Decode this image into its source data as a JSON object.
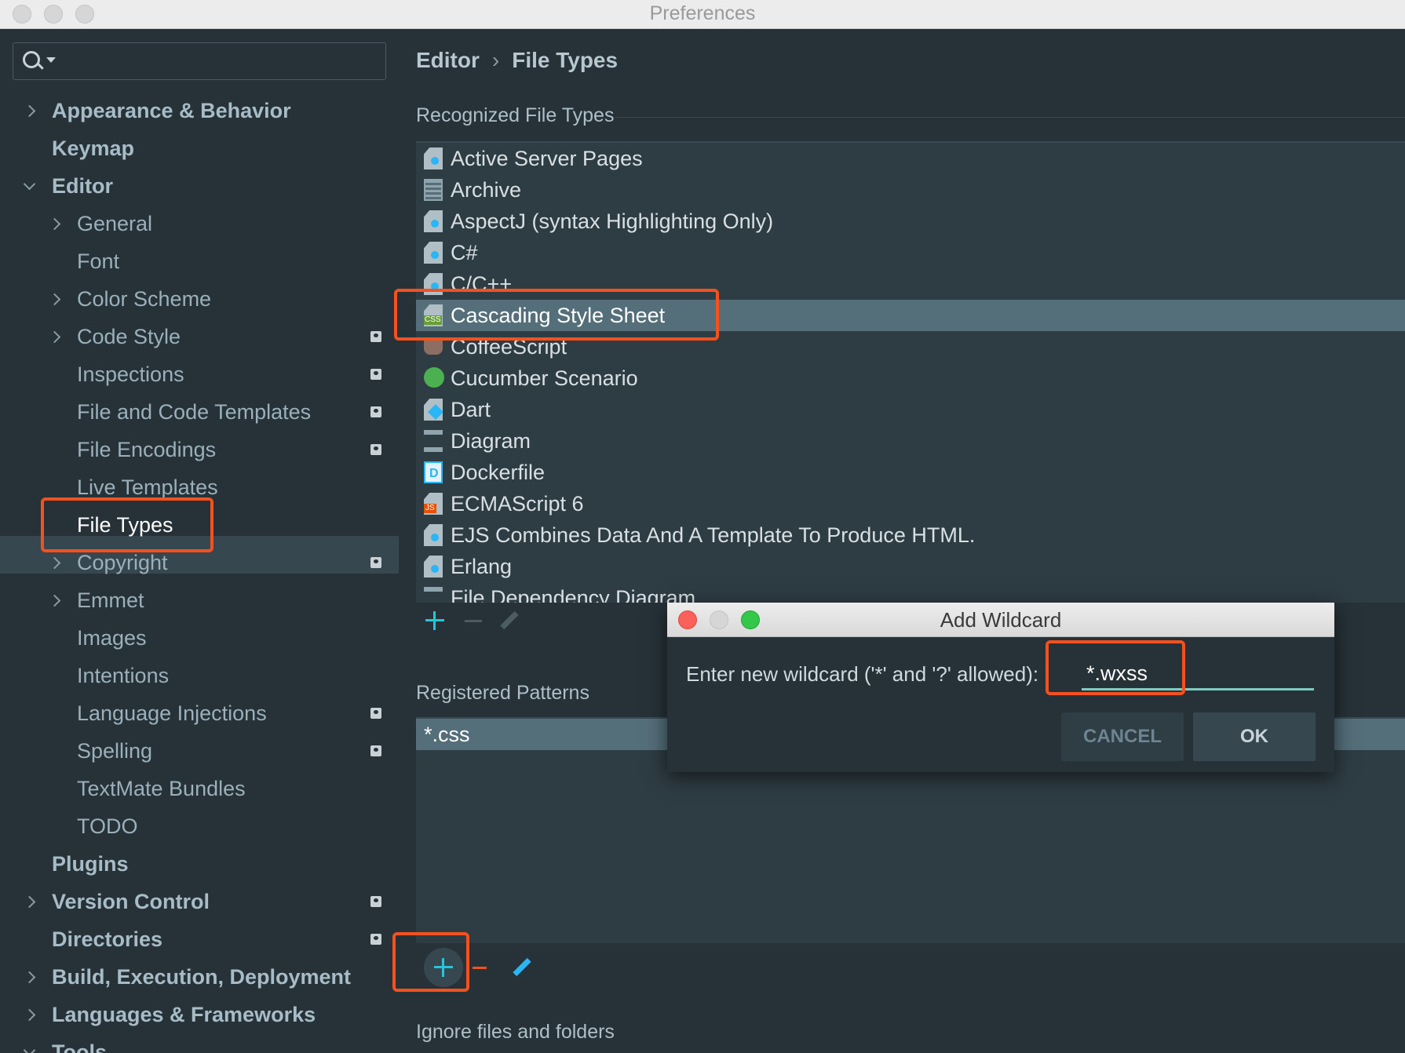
{
  "window": {
    "title": "Preferences"
  },
  "sidebar": {
    "items": [
      {
        "label": "Appearance & Behavior",
        "level": 0,
        "chevron": "right",
        "bold": true,
        "project": false
      },
      {
        "label": "Keymap",
        "level": 0,
        "chevron": "none",
        "bold": true,
        "project": false
      },
      {
        "label": "Editor",
        "level": 0,
        "chevron": "down",
        "bold": true,
        "project": false
      },
      {
        "label": "General",
        "level": 1,
        "chevron": "right",
        "bold": false,
        "project": false
      },
      {
        "label": "Font",
        "level": 1,
        "chevron": "none",
        "bold": false,
        "project": false
      },
      {
        "label": "Color Scheme",
        "level": 1,
        "chevron": "right",
        "bold": false,
        "project": false
      },
      {
        "label": "Code Style",
        "level": 1,
        "chevron": "right",
        "bold": false,
        "project": true
      },
      {
        "label": "Inspections",
        "level": 1,
        "chevron": "none",
        "bold": false,
        "project": true
      },
      {
        "label": "File and Code Templates",
        "level": 1,
        "chevron": "none",
        "bold": false,
        "project": true
      },
      {
        "label": "File Encodings",
        "level": 1,
        "chevron": "none",
        "bold": false,
        "project": true
      },
      {
        "label": "Live Templates",
        "level": 1,
        "chevron": "none",
        "bold": false,
        "project": false
      },
      {
        "label": "File Types",
        "level": 1,
        "chevron": "none",
        "bold": false,
        "project": false,
        "selected": true
      },
      {
        "label": "Copyright",
        "level": 1,
        "chevron": "right",
        "bold": false,
        "project": true
      },
      {
        "label": "Emmet",
        "level": 1,
        "chevron": "right",
        "bold": false,
        "project": false
      },
      {
        "label": "Images",
        "level": 1,
        "chevron": "none",
        "bold": false,
        "project": false
      },
      {
        "label": "Intentions",
        "level": 1,
        "chevron": "none",
        "bold": false,
        "project": false
      },
      {
        "label": "Language Injections",
        "level": 1,
        "chevron": "none",
        "bold": false,
        "project": true
      },
      {
        "label": "Spelling",
        "level": 1,
        "chevron": "none",
        "bold": false,
        "project": true
      },
      {
        "label": "TextMate Bundles",
        "level": 1,
        "chevron": "none",
        "bold": false,
        "project": false
      },
      {
        "label": "TODO",
        "level": 1,
        "chevron": "none",
        "bold": false,
        "project": false
      },
      {
        "label": "Plugins",
        "level": 0,
        "chevron": "none",
        "bold": true,
        "project": false
      },
      {
        "label": "Version Control",
        "level": 0,
        "chevron": "right",
        "bold": true,
        "project": true
      },
      {
        "label": "Directories",
        "level": 0,
        "chevron": "none",
        "bold": true,
        "project": true
      },
      {
        "label": "Build, Execution, Deployment",
        "level": 0,
        "chevron": "right",
        "bold": true,
        "project": false
      },
      {
        "label": "Languages & Frameworks",
        "level": 0,
        "chevron": "right",
        "bold": true,
        "project": false
      },
      {
        "label": "Tools",
        "level": 0,
        "chevron": "down",
        "bold": true,
        "project": false
      }
    ]
  },
  "breadcrumb": {
    "parent": "Editor",
    "separator": "›",
    "current": "File Types"
  },
  "recognized": {
    "label": "Recognized File Types",
    "items": [
      {
        "name": "Active Server Pages",
        "icon": "doc-icon"
      },
      {
        "name": "Archive",
        "icon": "zip-icon"
      },
      {
        "name": "AspectJ (syntax Highlighting Only)",
        "icon": "doc-icon"
      },
      {
        "name": "C#",
        "icon": "doc-icon"
      },
      {
        "name": "C/C++",
        "icon": "doc-icon"
      },
      {
        "name": "Cascading Style Sheet",
        "icon": "css-icon",
        "selected": true
      },
      {
        "name": "CoffeeScript",
        "icon": "coffee-icon"
      },
      {
        "name": "Cucumber Scenario",
        "icon": "cucumber-icon"
      },
      {
        "name": "Dart",
        "icon": "dart-icon"
      },
      {
        "name": "Diagram",
        "icon": "diagram-icon"
      },
      {
        "name": "Dockerfile",
        "icon": "docker-icon"
      },
      {
        "name": "ECMAScript 6",
        "icon": "js-icon"
      },
      {
        "name": "EJS Combines Data And A Template To Produce HTML.",
        "icon": "doc-icon"
      },
      {
        "name": "Erlang",
        "icon": "doc-icon"
      },
      {
        "name": "File Dependency Diagram",
        "icon": "diagram-icon"
      }
    ]
  },
  "patterns": {
    "label": "Registered Patterns",
    "items": [
      "*.css"
    ]
  },
  "ignore": {
    "label": "Ignore files and folders"
  },
  "dialog": {
    "title": "Add Wildcard",
    "prompt": "Enter new wildcard ('*' and '?' allowed):",
    "value": "*.wxss",
    "cancel_label": "CANCEL",
    "ok_label": "OK"
  },
  "colors": {
    "background": "#263238",
    "selection": "#546e7a",
    "accent": "#26c6da",
    "highlight": "#f4511e"
  }
}
